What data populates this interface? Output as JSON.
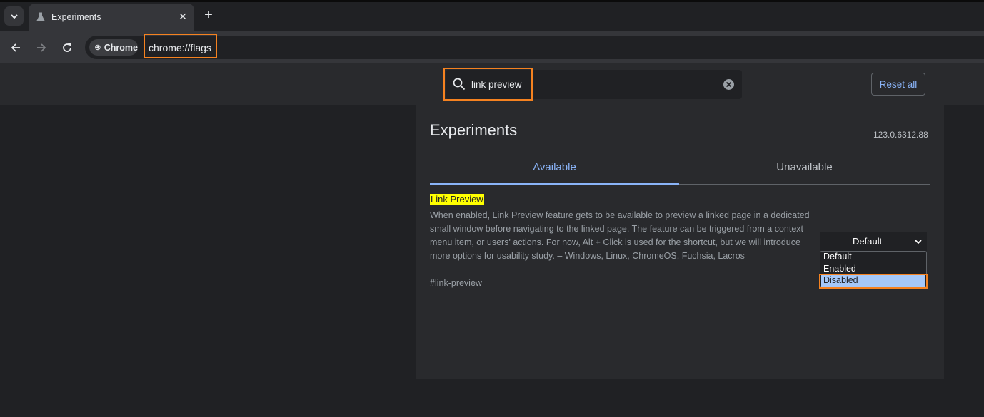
{
  "browser": {
    "tab_title": "Experiments",
    "omnibox_chip": "Chrome",
    "url": "chrome://flags"
  },
  "flags_page": {
    "search_value": "link preview",
    "reset_label": "Reset all",
    "title": "Experiments",
    "version": "123.0.6312.88",
    "tabs": [
      {
        "label": "Available",
        "active": true
      },
      {
        "label": "Unavailable",
        "active": false
      }
    ]
  },
  "flag": {
    "name": "Link Preview",
    "description": "When enabled, Link Preview feature gets to be available to preview a linked page in a dedicated small window before navigating to the linked page. The feature can be triggered from a context menu item, or users' actions. For now, Alt + Click is used for the shortcut, but we will introduce more options for usability study. – Windows, Linux, ChromeOS, Fuchsia, Lacros",
    "anchor": "#link-preview",
    "select_value": "Default",
    "options": [
      "Default",
      "Enabled",
      "Disabled"
    ],
    "highlighted_option": "Disabled"
  },
  "colors": {
    "highlight_box": "#f58220",
    "accent": "#8ab4f8",
    "search_highlight": "#ffff00"
  },
  "icons": [
    "chevron-down-icon",
    "flask-icon",
    "close-icon",
    "plus-icon",
    "back-arrow-icon",
    "forward-arrow-icon",
    "reload-icon",
    "chrome-logo-icon",
    "search-icon",
    "clear-icon"
  ]
}
